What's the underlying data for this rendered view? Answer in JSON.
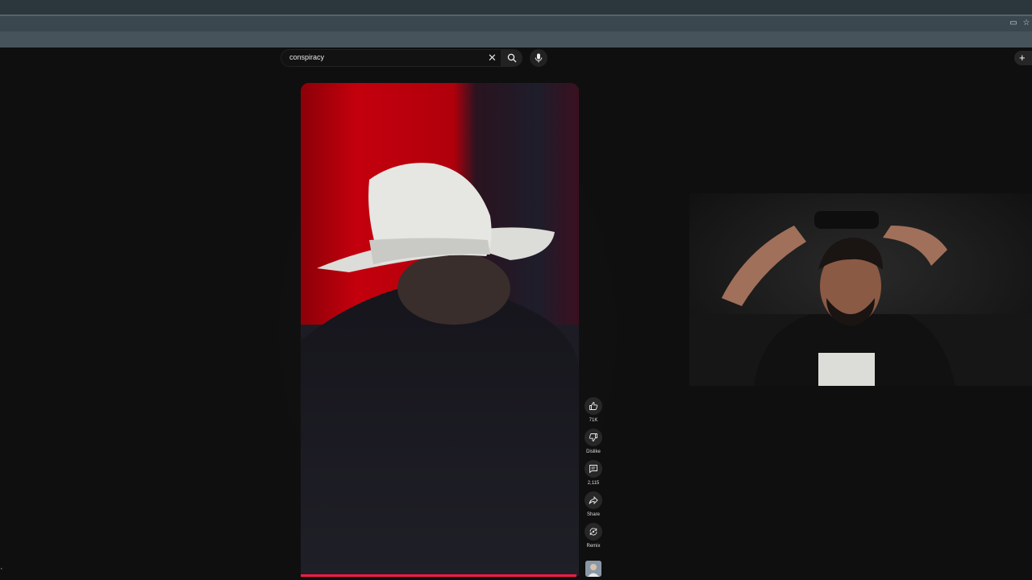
{
  "search": {
    "query": "conspiracy"
  },
  "video": {
    "likes_label": "71K",
    "dislike_label": "Dislike",
    "comments_label": "2,115",
    "share_label": "Share",
    "remix_label": "Remix",
    "progress": 0.99
  },
  "colors": {
    "progress": "#ff1a4a",
    "background": "#0f0f0f"
  },
  "icons": {
    "search": "search-icon",
    "mic": "mic-icon",
    "clear": "close-icon",
    "like": "thumbs-up-icon",
    "dislike": "thumbs-down-icon",
    "comment": "comment-icon",
    "share": "share-icon",
    "remix": "remix-icon",
    "create": "plus-icon"
  }
}
